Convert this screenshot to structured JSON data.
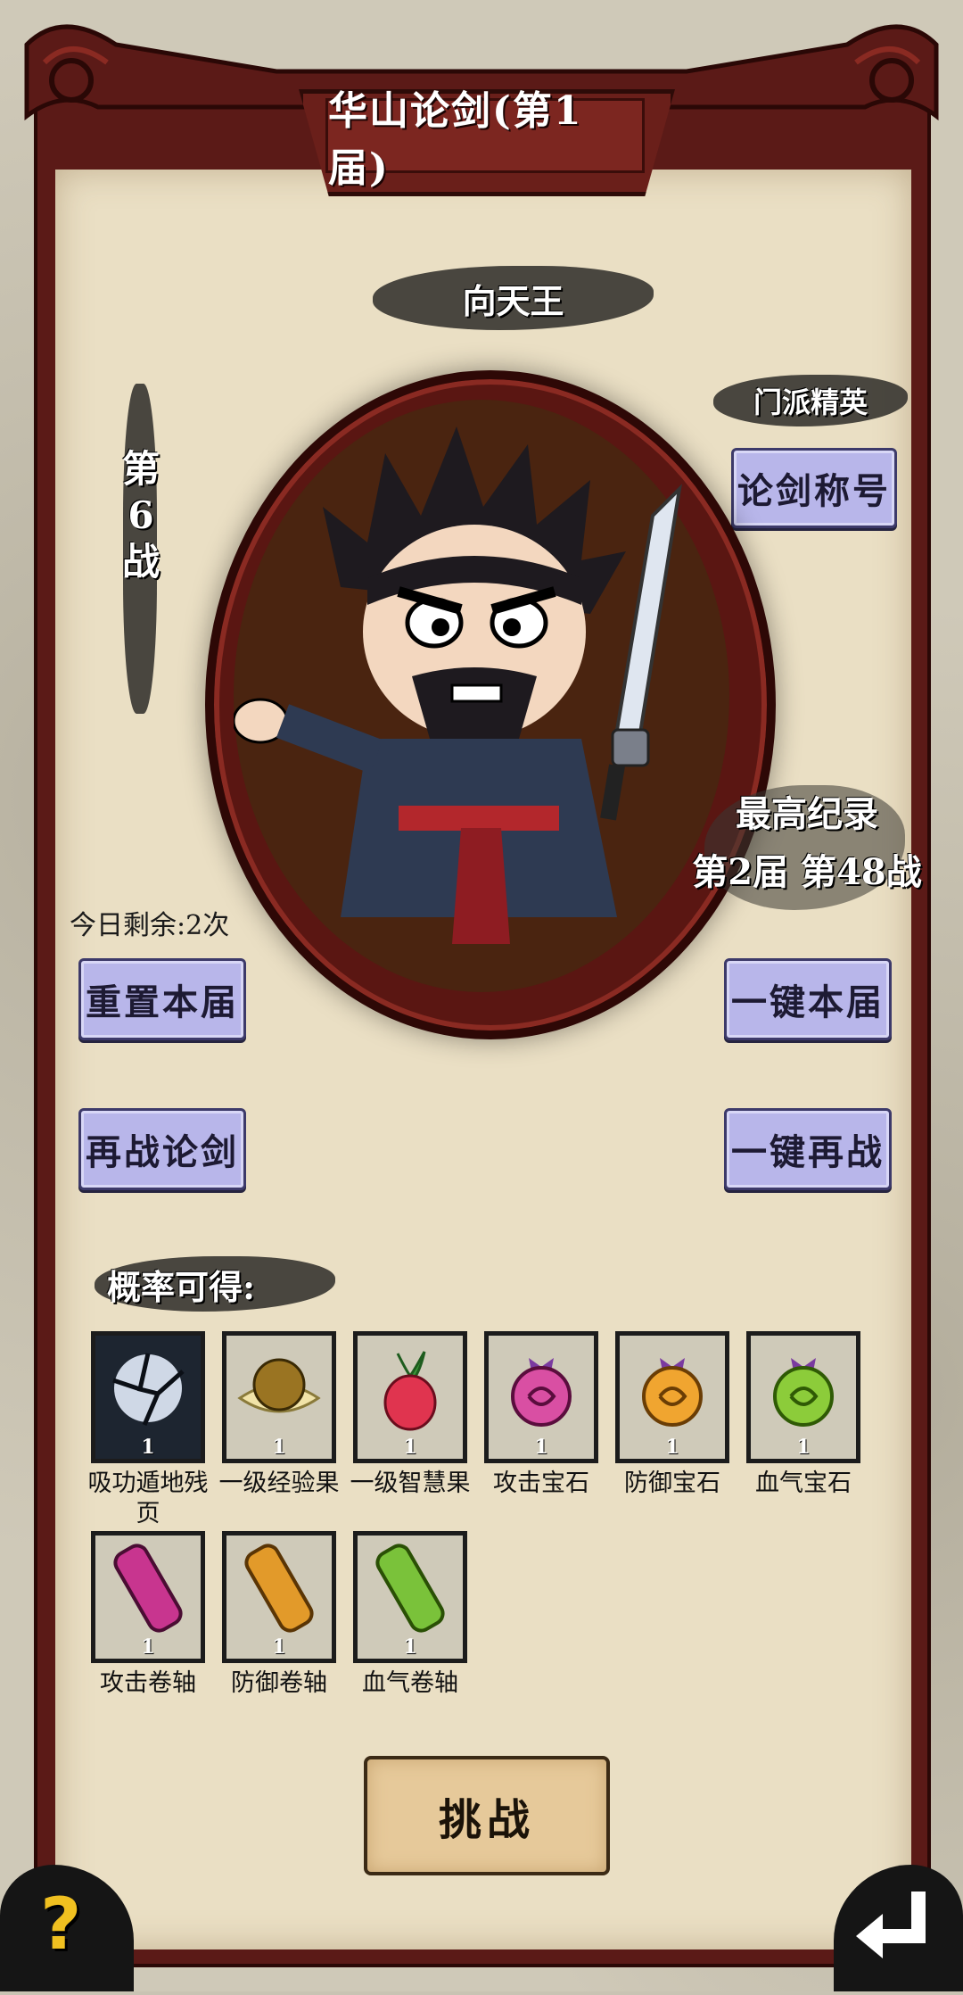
{
  "title": "华山论剑(第1届)",
  "opponent": {
    "name": "向天王"
  },
  "battle_index": {
    "chars": [
      "第",
      "6",
      "战"
    ]
  },
  "rank_badge": "门派精英",
  "buttons": {
    "title_btn": "论剑称号",
    "reset": "重置本届",
    "one_key_current": "一键本届",
    "rechallenge": "再战论剑",
    "one_key_again": "一键再战",
    "challenge": "挑战"
  },
  "record": {
    "label": "最高纪录",
    "value": "第2届 第48战"
  },
  "remaining": "今日剩余:2次",
  "drops": {
    "heading": "概率可得:",
    "items": [
      {
        "name": "吸功遁地残页",
        "count": "1",
        "icon": "cracked-fist-icon"
      },
      {
        "name": "一级经验果",
        "count": "1",
        "icon": "gold-fruit-icon"
      },
      {
        "name": "一级智慧果",
        "count": "1",
        "icon": "radish-icon"
      },
      {
        "name": "攻击宝石",
        "count": "1",
        "icon": "pink-gem-icon"
      },
      {
        "name": "防御宝石",
        "count": "1",
        "icon": "orange-gem-icon"
      },
      {
        "name": "血气宝石",
        "count": "1",
        "icon": "green-gem-icon"
      },
      {
        "name": "攻击卷轴",
        "count": "1",
        "icon": "pink-scroll-icon"
      },
      {
        "name": "防御卷轴",
        "count": "1",
        "icon": "orange-scroll-icon"
      },
      {
        "name": "血气卷轴",
        "count": "1",
        "icon": "green-scroll-icon"
      }
    ]
  },
  "corner": {
    "help": "?",
    "back_icon": "return-arrow-icon"
  }
}
